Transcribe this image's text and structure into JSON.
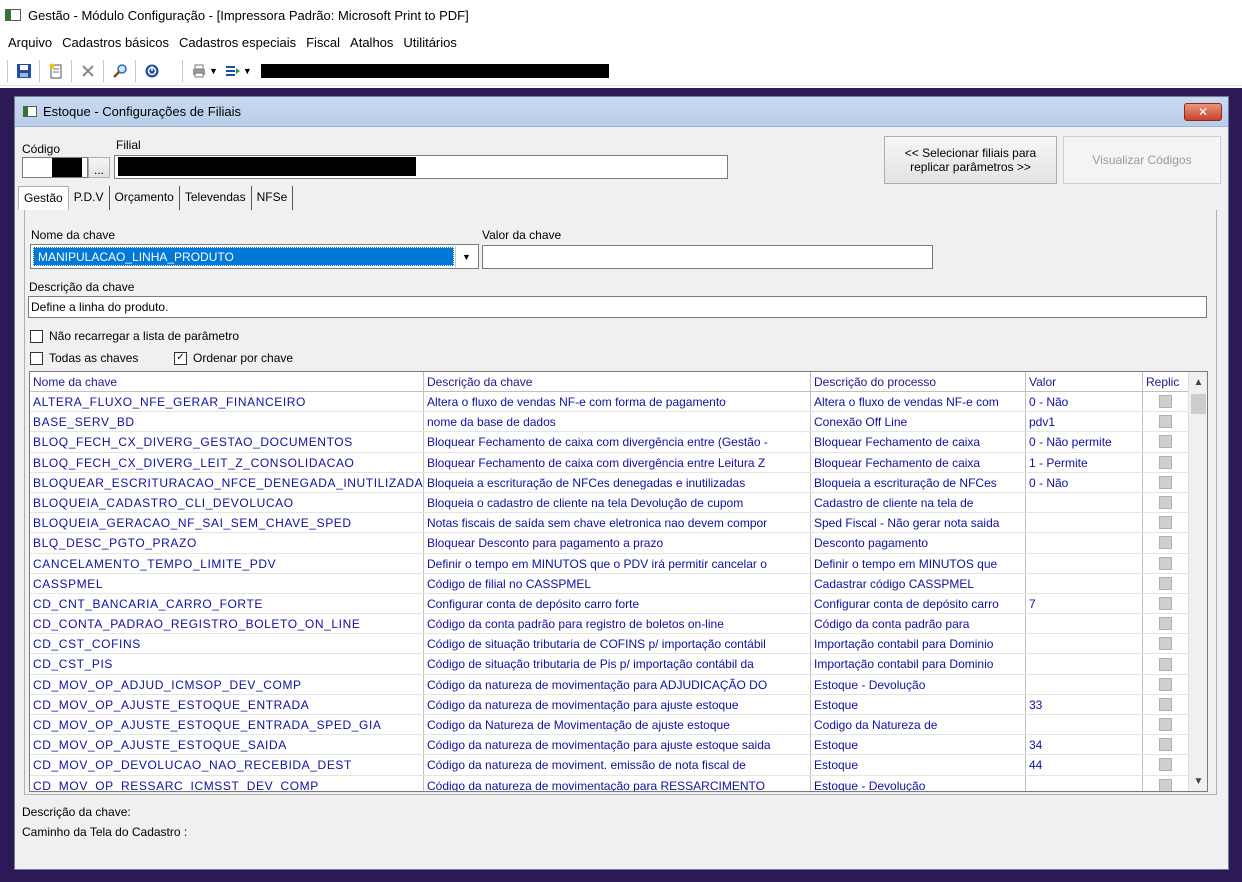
{
  "app": {
    "title": "Gestão  - Módulo Configuração - [Impressora Padrão: Microsoft Print to PDF]"
  },
  "menu": [
    "Arquivo",
    "Cadastros básicos",
    "Cadastros especiais",
    "Fiscal",
    "Atalhos",
    "Utilitários"
  ],
  "toolbar": {
    "icons": [
      "save-icon",
      "new-document-icon",
      "cancel-icon",
      "search-icon",
      "power-icon",
      "print-icon",
      "export-icon"
    ]
  },
  "window": {
    "title": "Estoque - Configurações de Filiais",
    "close": "✕"
  },
  "form": {
    "codigo_label": "Código",
    "filial_label": "Filial",
    "lookup_button": "...",
    "select_branches_button": "<< Selecionar filiais para replicar parâmetros >>",
    "view_codes_button": "Visualizar Códigos"
  },
  "tabs": [
    "Gestão",
    "P.D.V",
    "Orçamento",
    "Televendas",
    "NFSe"
  ],
  "key": {
    "name_label": "Nome da chave",
    "name_value": "MANIPULACAO_LINHA_PRODUTO",
    "value_label": "Valor da chave",
    "value_value": "",
    "desc_label": "Descrição da chave",
    "desc_value": "Define a linha do produto."
  },
  "options": {
    "no_reload": "Não recarregar a lista de parâmetro",
    "all_keys": "Todas as chaves",
    "sort_by_key": "Ordenar por chave"
  },
  "grid": {
    "columns": [
      "Nome da chave",
      "Descrição  da chave",
      "Descrição do processo",
      "Valor",
      "Replic"
    ],
    "rows": [
      [
        "ALTERA_FLUXO_NFE_GERAR_FINANCEIRO",
        "Altera o fluxo de vendas NF-e com forma de pagamento",
        "Altera o fluxo de vendas NF-e com",
        "0 - Não"
      ],
      [
        "BASE_SERV_BD",
        "nome da base de dados",
        "Conexão Off Line",
        "pdv1"
      ],
      [
        "BLOQ_FECH_CX_DIVERG_GESTAO_DOCUMENTOS",
        "Bloquear Fechamento de caixa com divergência entre (Gestão -",
        "Bloquear Fechamento de caixa",
        "0 - Não permite"
      ],
      [
        "BLOQ_FECH_CX_DIVERG_LEIT_Z_CONSOLIDACAO",
        "Bloquear Fechamento de caixa com divergência entre Leitura Z",
        "Bloquear Fechamento de caixa",
        "1 - Permite"
      ],
      [
        "BLOQUEAR_ESCRITURACAO_NFCE_DENEGADA_INUTILIZADA",
        "Bloqueia a escrituração de NFCes denegadas e inutilizadas",
        "Bloqueia a escrituração de NFCes",
        "0 - Não"
      ],
      [
        "BLOQUEIA_CADASTRO_CLI_DEVOLUCAO",
        "Bloqueia o cadastro de cliente na tela Devolução de cupom",
        "Cadastro de cliente na tela de",
        ""
      ],
      [
        "BLOQUEIA_GERACAO_NF_SAI_SEM_CHAVE_SPED",
        "Notas fiscais de saída sem chave eletronica nao devem compor",
        "Sped Fiscal - Não gerar nota saida",
        ""
      ],
      [
        "BLQ_DESC_PGTO_PRAZO",
        "Bloquear Desconto para pagamento a prazo",
        "Desconto pagamento",
        ""
      ],
      [
        "CANCELAMENTO_TEMPO_LIMITE_PDV",
        "Definir o tempo em MINUTOS que o PDV irá permitir cancelar o",
        "Definir o tempo em MINUTOS que",
        ""
      ],
      [
        "CASSPMEL",
        "Código de filial no CASSPMEL",
        "Cadastrar código CASSPMEL",
        ""
      ],
      [
        "CD_CNT_BANCARIA_CARRO_FORTE",
        "Configurar conta de depósito carro forte",
        "Configurar conta de depósito carro",
        "7"
      ],
      [
        "CD_CONTA_PADRAO_REGISTRO_BOLETO_ON_LINE",
        "Código da conta padrão para registro de boletos on-line",
        "Código da conta padrão para",
        ""
      ],
      [
        "CD_CST_COFINS",
        "Código de situação tributaria de COFINS  p/ importação contábil",
        "Importação contabil para Dominio",
        ""
      ],
      [
        "CD_CST_PIS",
        "Código de situação tributaria de Pis  p/ importação contábil da",
        "Importação contabil para Dominio",
        ""
      ],
      [
        "CD_MOV_OP_ADJUD_ICMSOP_DEV_COMP",
        "Código da natureza de movimentação para ADJUDICAÇÃO DO",
        "Estoque - Devolução",
        ""
      ],
      [
        "CD_MOV_OP_AJUSTE_ESTOQUE_ENTRADA",
        "Código da natureza de movimentação para ajuste estoque",
        "Estoque",
        "33"
      ],
      [
        "CD_MOV_OP_AJUSTE_ESTOQUE_ENTRADA_SPED_GIA",
        "Codigo da Natureza de Movimentação de ajuste estoque",
        "Codigo da Natureza de",
        ""
      ],
      [
        "CD_MOV_OP_AJUSTE_ESTOQUE_SAIDA",
        "Código da natureza de movimentação para ajuste estoque saida",
        "Estoque",
        "34"
      ],
      [
        "CD_MOV_OP_DEVOLUCAO_NAO_RECEBIDA_DEST",
        "Código da natureza de moviment. emissão de nota fiscal de",
        "Estoque",
        "44"
      ],
      [
        "CD_MOV_OP_RESSARC_ICMSST_DEV_COMP",
        "Código da natureza de movimentação para RESSARCIMENTO",
        "Estoque - Devolução",
        ""
      ]
    ]
  },
  "footer": {
    "desc_label": "Descrição da chave:",
    "path_label": "Caminho da Tela do Cadastro :"
  }
}
